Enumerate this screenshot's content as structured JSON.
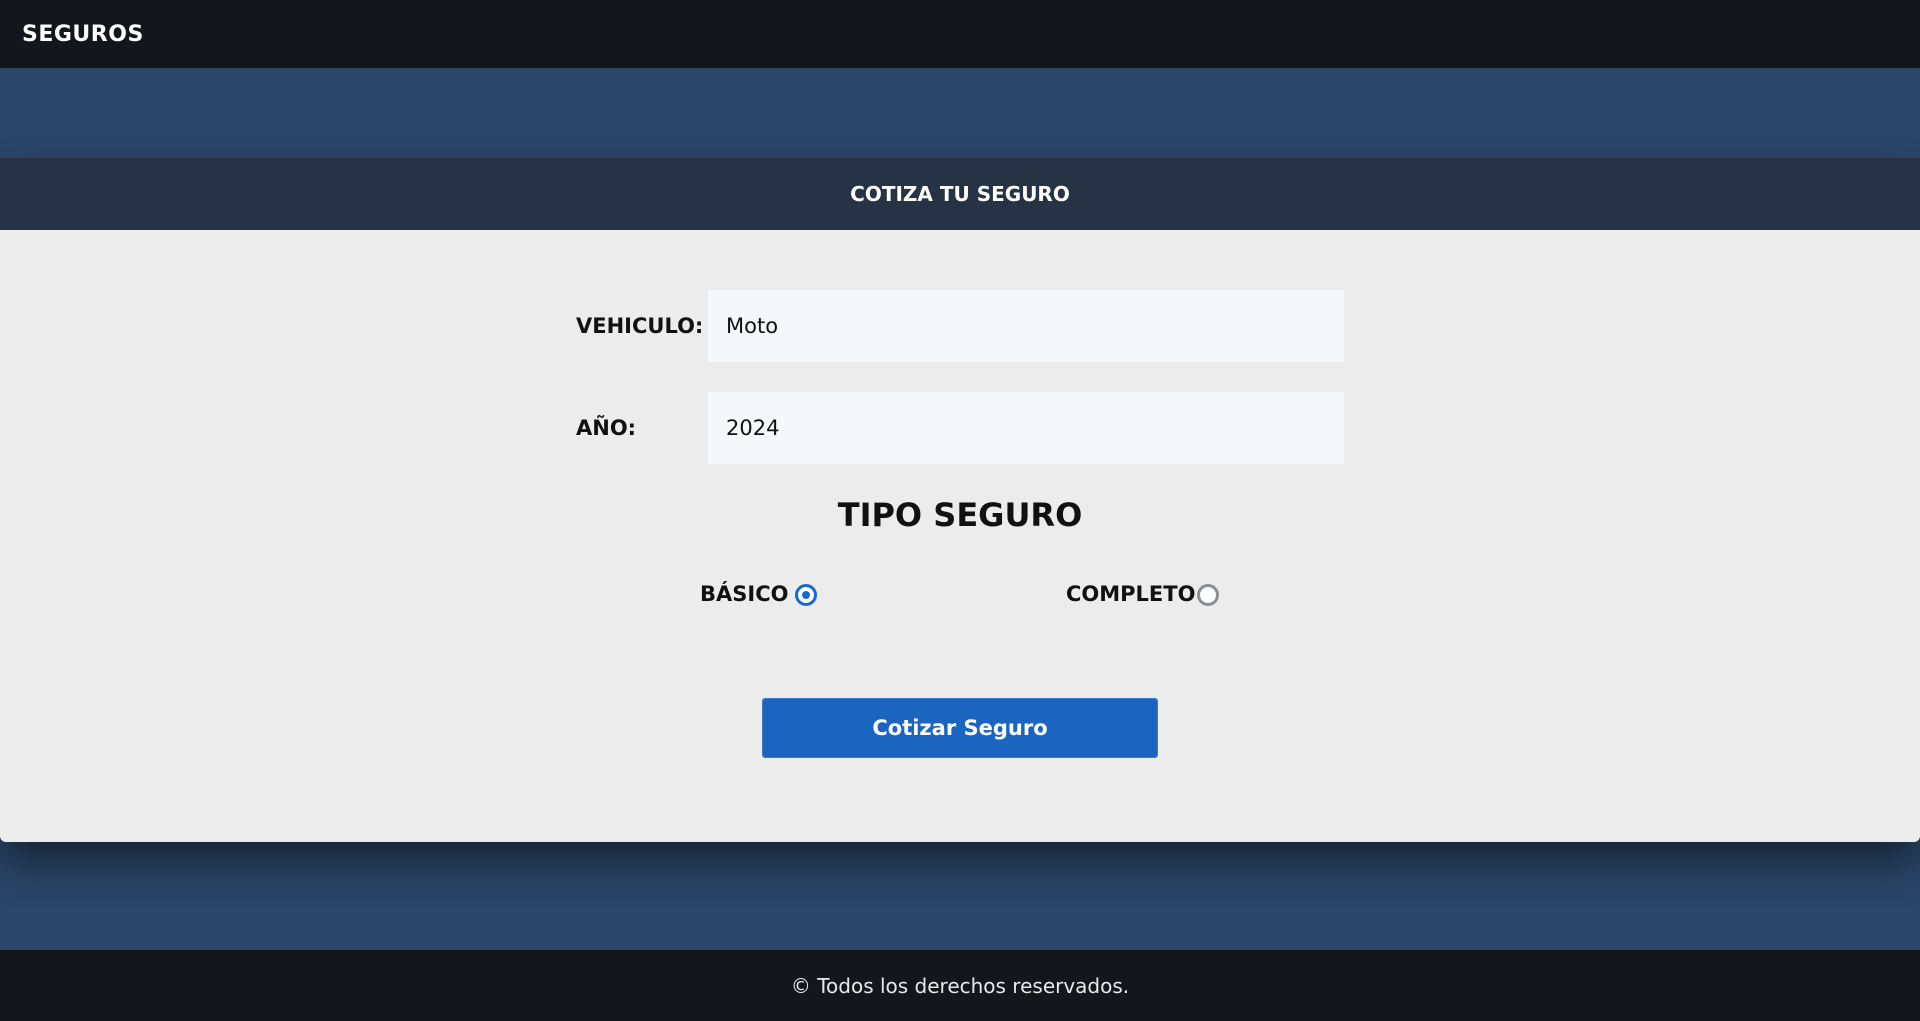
{
  "header": {
    "brand": "SEGUROS"
  },
  "form": {
    "title": "COTIZA TU SEGURO",
    "vehicle_label": "VEHICULO:",
    "vehicle_value": "Moto",
    "year_label": "AÑO:",
    "year_value": "2024",
    "type_title": "TIPO SEGURO",
    "options": [
      {
        "label": "BÁSICO",
        "selected": true
      },
      {
        "label": "COMPLETO",
        "selected": false
      }
    ],
    "submit_label": "Cotizar Seguro"
  },
  "footer": {
    "text": "© Todos los derechos reservados."
  },
  "colors": {
    "nav_bg": "#13161d",
    "page_bg": "#2a4669",
    "card_header_bg": "#263345",
    "card_bg": "#ececec",
    "accent": "#1b65c0"
  }
}
